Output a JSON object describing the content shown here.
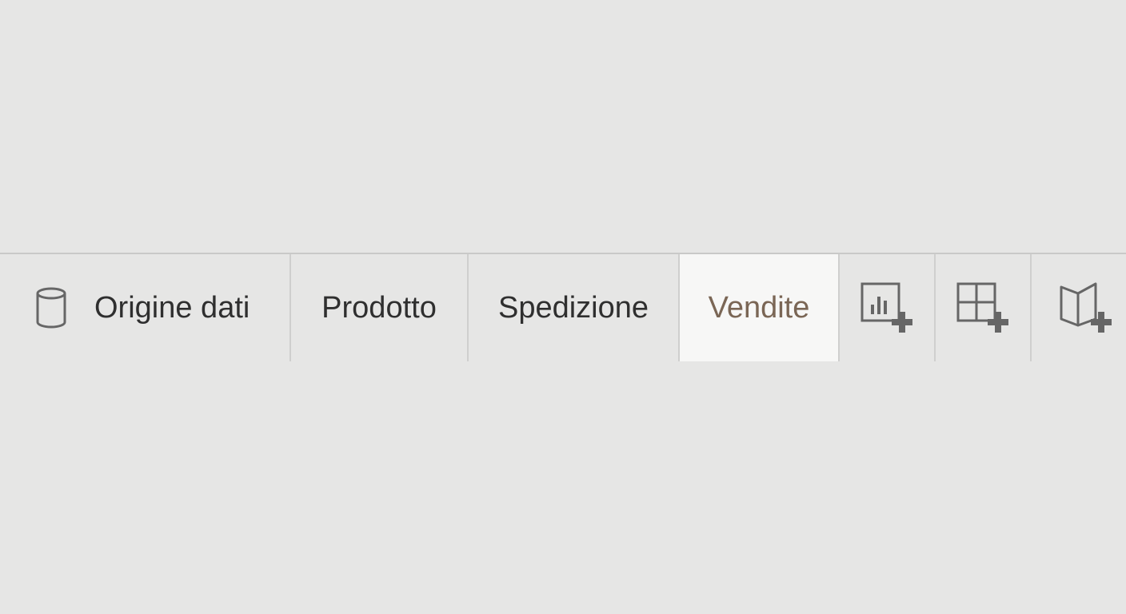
{
  "tabs": {
    "datasource": {
      "label": "Origine dati",
      "icon": "database-icon"
    },
    "sheets": [
      {
        "label": "Prodotto"
      },
      {
        "label": "Spedizione"
      },
      {
        "label": "Vendite",
        "active": true
      }
    ],
    "actions": [
      {
        "icon": "new-worksheet-icon"
      },
      {
        "icon": "new-dashboard-icon"
      },
      {
        "icon": "new-story-icon"
      }
    ]
  },
  "colors": {
    "background": "#e6e6e5",
    "active_tab_bg": "#f7f7f6",
    "active_tab_text": "#7a6655",
    "text": "#2f2f2f",
    "icon": "#666666"
  }
}
